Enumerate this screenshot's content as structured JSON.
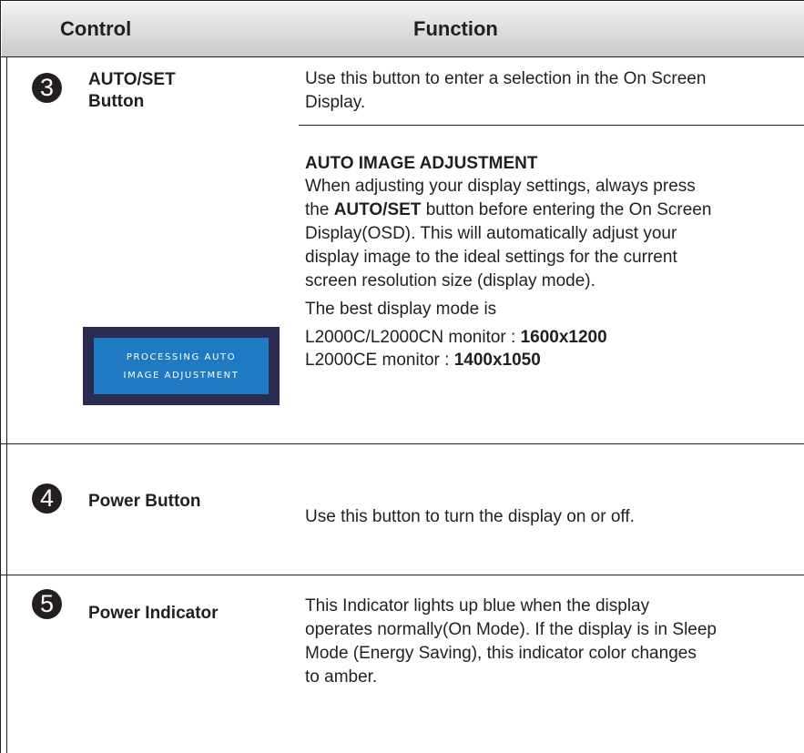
{
  "header": {
    "control": "Control",
    "function": "Function"
  },
  "rows": [
    {
      "number": "3",
      "control_line1": "AUTO/SET",
      "control_line2": "Button",
      "desc1_line1": "Use this button to enter a selection in the On Screen",
      "desc1_line2": "Display.",
      "heading": "AUTO IMAGE ADJUSTMENT",
      "para_line1": "When adjusting your display settings, always press",
      "para_line2_pre": "the ",
      "para_line2_bold": "AUTO/SET",
      "para_line2_post": " button before entering the On Screen",
      "para_line3": "Display(OSD). This will automatically adjust your",
      "para_line4": "display image to the ideal settings for the current",
      "para_line5": "screen resolution size (display mode).",
      "best_mode": "The best display mode is",
      "mode1_label": "L2000C/L2000CN monitor : ",
      "mode1_value": "1600x1200",
      "mode2_label": "L2000CE monitor : ",
      "mode2_value": "1400x1050",
      "osd_line1": "PROCESSING AUTO",
      "osd_line2": "IMAGE ADJUSTMENT"
    },
    {
      "number": "4",
      "control": "Power Button",
      "desc": "Use this button to turn the display on or off."
    },
    {
      "number": "5",
      "control": "Power Indicator",
      "desc_line1": "This Indicator lights up blue when the display",
      "desc_line2": "operates normally(On Mode). If the display is in Sleep",
      "desc_line3": "Mode (Energy Saving), this indicator color changes",
      "desc_line4": "to amber."
    }
  ]
}
